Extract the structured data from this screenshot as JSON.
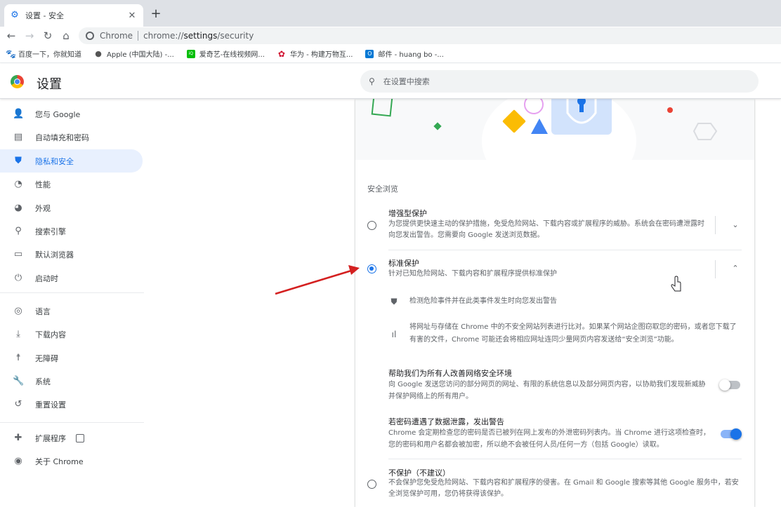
{
  "tab": {
    "title": "设置 - 安全",
    "favicon": "gear-icon",
    "close": "✕"
  },
  "toolbar": {
    "newtab": "+",
    "site": "Chrome",
    "url_prefix": "chrome://",
    "url_main": "settings",
    "url_rest": "/security"
  },
  "bookmarks": [
    {
      "label": "百度一下，你就知道",
      "icon": "baidu-icon",
      "color": "#2932e1"
    },
    {
      "label": "Apple (中国大陆) -...",
      "icon": "apple-icon",
      "color": "#555555"
    },
    {
      "label": "爱奇艺-在线视频网...",
      "icon": "iqiyi-icon",
      "color": "#00be06"
    },
    {
      "label": "华为 - 构建万物互...",
      "icon": "huawei-icon",
      "color": "#cf0a2c"
    },
    {
      "label": "邮件 - huang bo -...",
      "icon": "outlook-icon",
      "color": "#0078d4"
    }
  ],
  "header": {
    "title": "设置",
    "search_placeholder": "在设置中搜索"
  },
  "sidebar": {
    "items": [
      {
        "label": "您与 Google",
        "icon": "person-icon"
      },
      {
        "label": "自动填充和密码",
        "icon": "clipboard-icon"
      },
      {
        "label": "隐私和安全",
        "icon": "shield-icon",
        "active": true
      },
      {
        "label": "性能",
        "icon": "speedometer-icon"
      },
      {
        "label": "外观",
        "icon": "palette-icon"
      },
      {
        "label": "搜索引擎",
        "icon": "search-icon"
      },
      {
        "label": "默认浏览器",
        "icon": "browser-icon"
      },
      {
        "label": "启动时",
        "icon": "power-icon"
      },
      {
        "label": "语言",
        "icon": "globe-icon"
      },
      {
        "label": "下载内容",
        "icon": "download-icon"
      },
      {
        "label": "无障碍",
        "icon": "accessibility-icon"
      },
      {
        "label": "系统",
        "icon": "wrench-icon"
      },
      {
        "label": "重置设置",
        "icon": "history-icon"
      },
      {
        "label": "扩展程序",
        "icon": "puzzle-icon"
      },
      {
        "label": "关于 Chrome",
        "icon": "chrome-icon"
      }
    ]
  },
  "main": {
    "section_title": "安全浏览",
    "enhanced": {
      "title": "增强型保护",
      "desc": "为您提供更快速主动的保护措施，免受危险网站、下载内容或扩展程序的威胁。系统会在密码遭泄露时向您发出警告。您需要向 Google 发送浏览数据。"
    },
    "standard": {
      "title": "标准保护",
      "desc": "针对已知危险网站、下载内容和扩展程序提供标准保护",
      "detail1": "检测危险事件并在此类事件发生时向您发出警告",
      "detail2": "将网址与存储在 Chrome 中的不安全网站列表进行比对。如果某个网站企图窃取您的密码，或者您下载了有害的文件，Chrome 可能还会将相应网址连同少量网页内容发送给“安全浏览”功能。",
      "improve_title": "帮助我们为所有人改善网络安全环境",
      "improve_desc": "向 Google 发送您访问的部分网页的网址、有限的系统信息以及部分网页内容，以协助我们发现新威胁并保护网络上的所有用户。",
      "improve_on": false,
      "breach_title": "若密码遭遇了数据泄露，发出警告",
      "breach_desc": "Chrome 会定期检查您的密码是否已被列在网上发布的外泄密码列表内。当 Chrome 进行这项检查时，您的密码和用户名都会被加密，所以绝不会被任何人员/任何一方（包括 Google）读取。",
      "breach_on": true
    },
    "noprotect": {
      "title": "不保护（不建议）",
      "desc": "不会保护您免受危险网站、下载内容和扩展程序的侵害。在 Gmail 和 Google 搜索等其他 Google 服务中，若安全浏览保护可用，您仍将获得该保护。"
    }
  },
  "colors": {
    "accent": "#1a73e8",
    "arrow": "#d42020"
  }
}
